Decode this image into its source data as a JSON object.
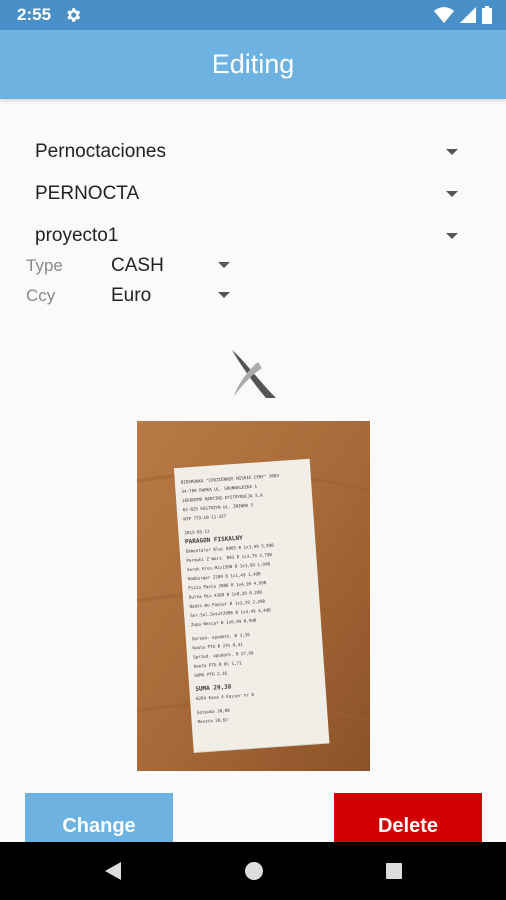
{
  "status_bar": {
    "time": "2:55"
  },
  "app_bar": {
    "title": "Editing"
  },
  "form": {
    "category": "Pernoctaciones",
    "subcategory": "PERNOCTA",
    "project": "proyecto1",
    "type_label": "Type",
    "type_value": "CASH",
    "ccy_label": "Ccy",
    "ccy_value": "Euro"
  },
  "buttons": {
    "change": "Change",
    "delete": "Delete"
  },
  "colors": {
    "status_bar": "#4a90c8",
    "app_bar": "#6eb2e1",
    "change_button": "#6eb2e1",
    "delete_button": "#d10000"
  },
  "receipt_lines": [
    "BIEDRONKA \"CODZIENNIE NISKIE CENY\" 3083",
    "34-700 RABKA UL. GRUNWALDZKA 1",
    "JERONIMO MARTINS DYSTRYBUCJA S.A.",
    "62-025 KOSTRZYN UL. ZNIWNA 5",
    "NIP 779-10-11-327",
    "2015-05-12",
    "PARAGON FISKALNY",
    "Emmentaler Bloc 0065  B   1x3,99  3,99B",
    "Parowki Z Warz.  093 B    1x3,79  3,79B",
    "Serek Kres.Mix1500 B      1x1,99  1,99B",
    "Hamburger 2200   B        1x1,49  1,49B",
    "Pizza Pasta 2806  B       1x4,99  4,99B",
    "Bulka Mix 4380   B        1x0,29  0,29B",
    "Nadzi.Wo Papier  B        1x2,29  2,29B",
    "Ser.Sol.Swiat2906 B       1x4,49  4,49B",
    "Zupa Nescaf  B            1x0,99  0,99B",
    "Sprzed. opodatk. B   3,39",
    "Kwota PTU B 23%      0,41",
    "Sprzed. opodatk. B  27,99",
    "Kwota PTU B 8%       1,71",
    "SUMA PTU             2,16",
    "SUMA            29,38",
    "0264 Kasa 4   Kasjer nr 8",
    "Gotowka        30,00",
    "Reszta          20,62"
  ]
}
